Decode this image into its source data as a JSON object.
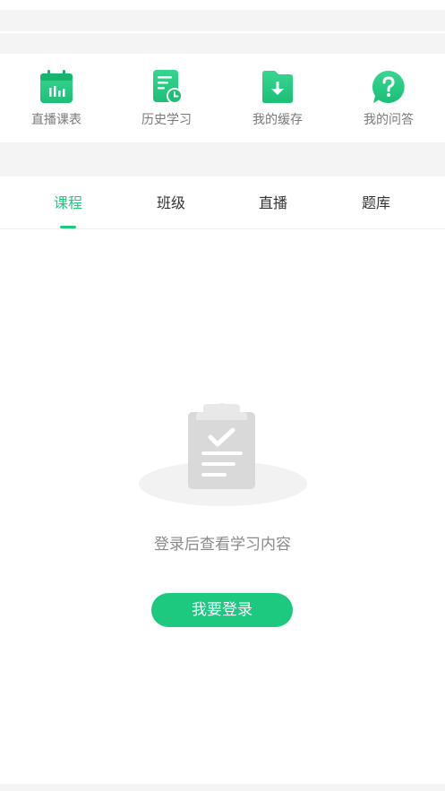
{
  "shortcuts": [
    {
      "label": "直播课表",
      "icon": "calendar-chart-icon"
    },
    {
      "label": "历史学习",
      "icon": "document-clock-icon"
    },
    {
      "label": "我的缓存",
      "icon": "folder-download-icon"
    },
    {
      "label": "我的问答",
      "icon": "question-bubble-icon"
    }
  ],
  "tabs": [
    {
      "label": "课程",
      "active": true
    },
    {
      "label": "班级",
      "active": false
    },
    {
      "label": "直播",
      "active": false
    },
    {
      "label": "题库",
      "active": false
    }
  ],
  "empty_state": {
    "icon": "clipboard-check-icon",
    "message": "登录后查看学习内容",
    "login_button": "我要登录"
  },
  "colors": {
    "accent": "#1dc97f",
    "background_band": "#f4f4f4",
    "label_gray": "#7a7a7a"
  }
}
